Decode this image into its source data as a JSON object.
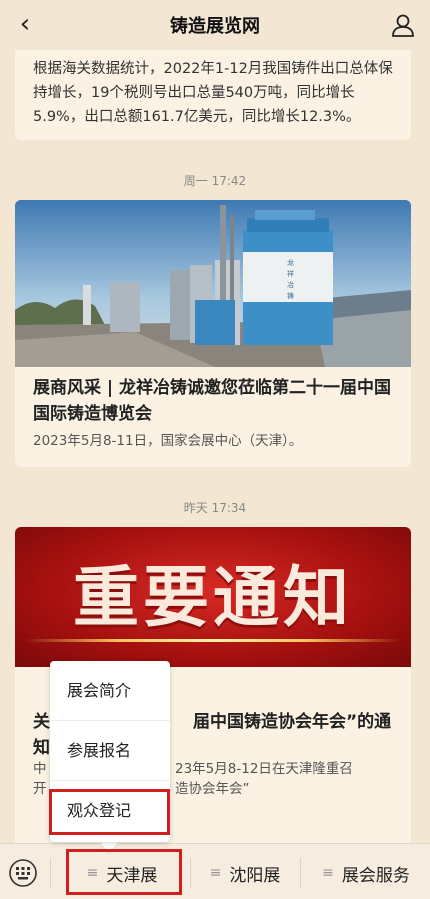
{
  "header": {
    "back_icon": "chevron-left-icon",
    "title": "铸造展览网",
    "user_icon": "user-icon"
  },
  "feed": [
    {
      "body": "根据海关数据统计，2022年1-12月我国铸件出口总体保持增长，19个税则号出口总量540万吨，同比增长5.9%，出口总额161.7亿美元，同比增长12.3%。"
    },
    {
      "time": "周一 17:42",
      "title": "展商风采 | 龙祥冶铸诚邀您莅临第二十一届中国国际铸造博览会",
      "summary": "2023年5月8-11日，国家会展中心（天津）。",
      "image_text": "龙祥冶铸"
    },
    {
      "time": "昨天 17:34",
      "banner_text": "重要通知",
      "title_start": "关",
      "title_end": "届中国铸造协会年会”的通",
      "title_line2": "知",
      "summary_line1_start": "中",
      "summary_line1_end": "23年5月8-12日在天津隆重召",
      "summary_line2_start": "开",
      "summary_line2_end": "造协会年会”"
    }
  ],
  "popup_menu": {
    "items": [
      "展会简介",
      "参展报名",
      "观众登记"
    ],
    "highlighted": "观众登记"
  },
  "bottom_menu": {
    "keyboard_icon": "keyboard-icon",
    "items": [
      {
        "label": "天津展",
        "icon": "menu-lines-icon"
      },
      {
        "label": "沈阳展",
        "icon": "menu-lines-icon"
      },
      {
        "label": "展会服务",
        "icon": "menu-lines-icon"
      }
    ],
    "highlighted": "天津展"
  },
  "colors": {
    "background": "#f3e6d3",
    "card": "#fbf2e4",
    "highlight_border": "#d0201d",
    "banner_red": "#c41a18"
  }
}
